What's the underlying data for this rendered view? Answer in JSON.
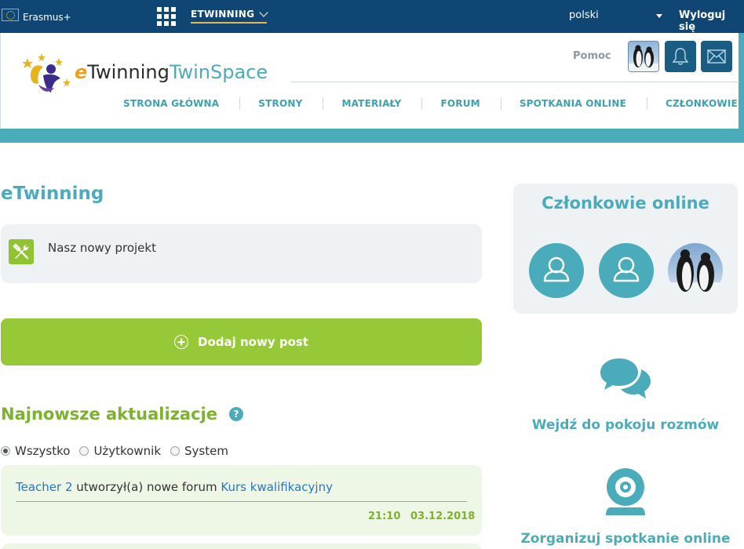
{
  "topbar": {
    "erasmus": "Erasmus+",
    "menu_label": "ETWINNING",
    "language": "polski",
    "logout": "Wyloguj się"
  },
  "header": {
    "logo_e": "e",
    "logo_twinning": "Twinning",
    "logo_space": "TwinSpace",
    "help": "Pomoc",
    "nav": [
      {
        "label": "STRONA GŁÓWNA"
      },
      {
        "label": "STRONY"
      },
      {
        "label": "MATERIAŁY"
      },
      {
        "label": "FORUM"
      },
      {
        "label": "SPOTKANIA ONLINE"
      },
      {
        "label": "CZŁONKOWIE"
      }
    ]
  },
  "main": {
    "title": "eTwinning",
    "project_name": "Nasz nowy projekt",
    "add_post": "Dodaj nowy post",
    "updates_title": "Najnowsze aktualizacje",
    "help_mark": "?",
    "filters": [
      {
        "label": "Wszystko",
        "selected": true
      },
      {
        "label": "Użytkownik",
        "selected": false
      },
      {
        "label": "System",
        "selected": false
      }
    ],
    "update": {
      "user": "Teacher 2",
      "action": " utworzył(a) nowe forum ",
      "target": "Kurs kwalifikacyjny",
      "time": "21:10",
      "date": "03.12.2018"
    }
  },
  "sidebar": {
    "online_title": "Członkowie online",
    "chat_label": "Wejdź do pokoju rozmów",
    "meet_label": "Zorganizuj spotkanie online"
  },
  "colors": {
    "topbar": "#0f4673",
    "teal": "#4aacbb",
    "green": "#96c838",
    "link": "#2777c4"
  }
}
